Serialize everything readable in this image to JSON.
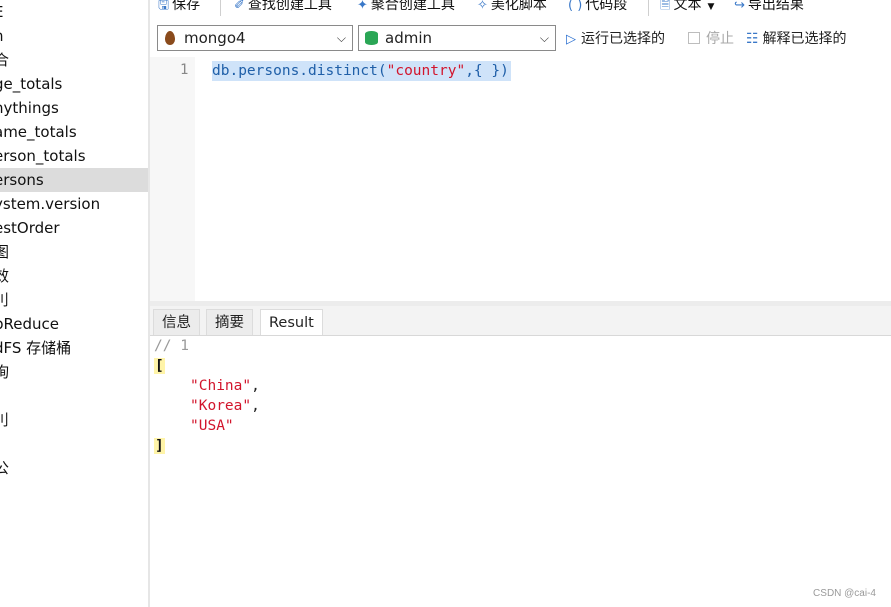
{
  "sidebar": {
    "items": [
      {
        "label": "E",
        "selected": false
      },
      {
        "label": "n",
        "selected": false
      },
      {
        "label": "合",
        "selected": false
      },
      {
        "label": "ge_totals",
        "selected": false
      },
      {
        "label": "nythings",
        "selected": false
      },
      {
        "label": "ame_totals",
        "selected": false
      },
      {
        "label": "erson_totals",
        "selected": false
      },
      {
        "label": "ersons",
        "selected": true
      },
      {
        "label": "ystem.version",
        "selected": false
      },
      {
        "label": "estOrder",
        "selected": false
      },
      {
        "label": "图",
        "selected": false
      },
      {
        "label": "效",
        "selected": false
      },
      {
        "label": "刂",
        "selected": false
      },
      {
        "label": "pReduce",
        "selected": false
      },
      {
        "label": "dFS 存储桶",
        "selected": false
      },
      {
        "label": "询",
        "selected": false
      },
      {
        "label": "",
        "selected": false
      },
      {
        "label": "刂",
        "selected": false
      },
      {
        "label": "",
        "selected": false
      },
      {
        "label": "公",
        "selected": false
      }
    ]
  },
  "toolbar": {
    "save": "保存",
    "find_builder": "查找创建工具",
    "aggregate_builder": "聚合创建工具",
    "beautify": "美化脚本",
    "snippet": "代码段",
    "text": "文本",
    "export": "导出结果"
  },
  "connection": {
    "server": "mongo4",
    "database": "admin",
    "run_selected": "运行已选择的",
    "stop": "停止",
    "explain_selected": "解释已选择的"
  },
  "editor": {
    "line_number": "1",
    "code_prefix": "db.persons.distinct(",
    "code_string": "\"country\"",
    "code_suffix": ",{ })"
  },
  "result_tabs": {
    "info": "信息",
    "summary": "摘要",
    "result": "Result",
    "active": "Result"
  },
  "result": {
    "comment": "// 1",
    "open_bracket": "[",
    "values": [
      "\"China\"",
      "\"Korea\"",
      "\"USA\""
    ],
    "close_bracket": "]"
  },
  "watermark": "CSDN @cai-4",
  "colors": {
    "selection": "#cfe3f9",
    "string": "#d2152c",
    "code": "#1f5fa8",
    "bracket_highlight": "#fff4a8",
    "sidebar_selected": "#dcdcdc"
  }
}
